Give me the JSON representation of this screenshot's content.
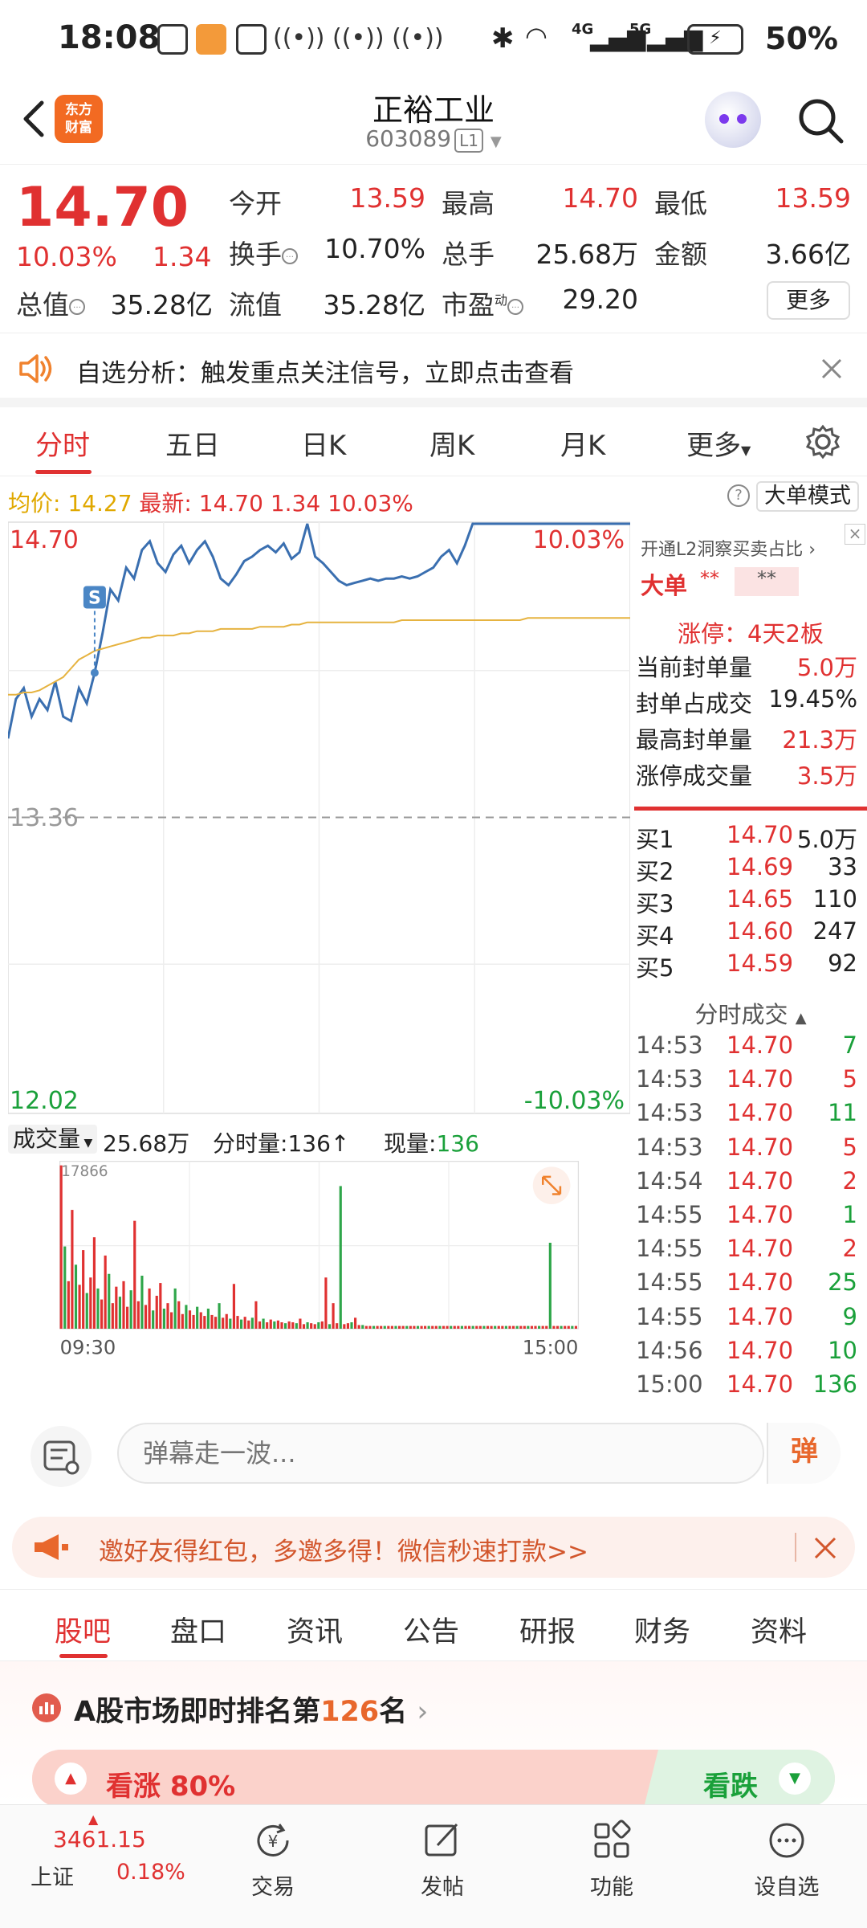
{
  "status_bar": {
    "time": "18:08",
    "net_4g": "4G",
    "net_5g": "5G",
    "battery": "50%"
  },
  "header": {
    "brand": "东方财富",
    "stock_name": "正裕工业",
    "stock_code": "603089",
    "level": "L1"
  },
  "quote": {
    "price": "14.70",
    "change_pct": "10.03%",
    "change": "1.34",
    "fields": [
      {
        "label": "今开",
        "value": "13.59"
      },
      {
        "label": "最高",
        "value": "14.70"
      },
      {
        "label": "最低",
        "value": "13.59"
      },
      {
        "label": "换手",
        "value": "10.70%"
      },
      {
        "label": "总手",
        "value": "25.68万"
      },
      {
        "label": "金额",
        "value": "3.66亿"
      },
      {
        "label": "总值",
        "value": "35.28亿"
      },
      {
        "label": "流值",
        "value": "35.28亿"
      },
      {
        "label": "市盈",
        "value": "29.20"
      }
    ],
    "pe_sup": "动",
    "more": "更多"
  },
  "banner": {
    "text": "自选分析：触发重点关注信号，立即点击查看"
  },
  "chart_tabs": [
    "分时",
    "五日",
    "日K",
    "周K",
    "月K",
    "更多"
  ],
  "avg_line": {
    "avg_label": "均价:",
    "avg_value": "14.27",
    "latest_label": "最新:",
    "latest_value": "14.70",
    "change": "1.34",
    "pct": "10.03%",
    "big_order_mode": "大单模式"
  },
  "chart_data": {
    "type": "line",
    "y_top_label": "14.70",
    "y_mid_label": "13.36",
    "y_bottom_label": "12.02",
    "pct_top_label": "10.03%",
    "pct_bottom_label": "-10.03%",
    "ylim": [
      12.02,
      14.7
    ],
    "reference": 13.36,
    "x_start": "09:30",
    "x_end": "15:00",
    "series": [
      {
        "values": [
          13.72,
          13.9,
          13.95,
          13.82,
          13.9,
          13.85,
          13.98,
          13.82,
          13.8,
          13.95,
          13.88,
          14.02,
          14.2,
          14.4,
          14.35,
          14.5,
          14.45,
          14.58,
          14.62,
          14.52,
          14.48,
          14.56,
          14.6,
          14.52,
          14.58,
          14.62,
          14.55,
          14.45,
          14.42,
          14.47,
          14.53,
          14.55,
          14.58,
          14.6,
          14.57,
          14.61,
          14.54,
          14.57,
          14.7,
          14.55,
          14.52,
          14.48,
          14.44,
          14.42,
          14.43,
          14.44,
          14.45,
          14.44,
          14.45,
          14.45,
          14.46,
          14.45,
          14.46,
          14.48,
          14.5,
          14.55,
          14.58,
          14.52,
          14.6,
          14.7,
          14.7,
          14.7,
          14.7,
          14.7,
          14.7,
          14.7,
          14.7,
          14.7,
          14.7,
          14.7,
          14.7,
          14.7,
          14.7,
          14.7,
          14.7,
          14.7,
          14.7,
          14.7,
          14.7,
          14.7
        ]
      },
      {
        "values": [
          13.92,
          13.92,
          13.93,
          13.93,
          13.94,
          13.96,
          13.98,
          14.0,
          14.04,
          14.08,
          14.1,
          14.12,
          14.13,
          14.14,
          14.15,
          14.16,
          14.17,
          14.18,
          14.18,
          14.19,
          14.19,
          14.19,
          14.2,
          14.2,
          14.21,
          14.21,
          14.21,
          14.22,
          14.22,
          14.22,
          14.22,
          14.22,
          14.23,
          14.23,
          14.23,
          14.23,
          14.24,
          14.24,
          14.25,
          14.25,
          14.25,
          14.25,
          14.25,
          14.25,
          14.25,
          14.25,
          14.25,
          14.25,
          14.25,
          14.25,
          14.26,
          14.26,
          14.26,
          14.26,
          14.26,
          14.26,
          14.26,
          14.26,
          14.26,
          14.26,
          14.26,
          14.26,
          14.26,
          14.26,
          14.26,
          14.26,
          14.27,
          14.27,
          14.27,
          14.27,
          14.27,
          14.27,
          14.27,
          14.27,
          14.27,
          14.27,
          14.27,
          14.27,
          14.27,
          14.27
        ]
      }
    ],
    "marker": "S"
  },
  "volume": {
    "label": "成交量",
    "total": "25.68万",
    "minute_label": "分时量:",
    "minute_value": "136",
    "current_label": "现量:",
    "current_value": "136",
    "max_label": "17866",
    "bars": [
      17866,
      9000,
      5200,
      13000,
      7000,
      4800,
      8600,
      3900,
      5600,
      10000,
      4400,
      3200,
      8000,
      6000,
      2800,
      4600,
      3500,
      5200,
      2400,
      4200,
      11800,
      3000,
      5800,
      2600,
      4400,
      2000,
      3600,
      5000,
      2200,
      2800,
      1800,
      4400,
      3000,
      1600,
      2600,
      2000,
      1500,
      2400,
      1800,
      1400,
      2200,
      1500,
      1300,
      2800,
      1200,
      1600,
      1100,
      4900,
      1400,
      1000,
      1300,
      900,
      1200,
      3000,
      800,
      1100,
      700,
      1000,
      800,
      900,
      700,
      600,
      800,
      700,
      600,
      1100,
      500,
      700,
      600,
      500,
      700,
      800,
      5600,
      500,
      2800,
      600,
      15600,
      500,
      600,
      700,
      1200,
      400,
      400,
      300,
      300,
      300,
      300,
      300,
      300,
      300,
      300,
      300,
      300,
      300,
      300,
      300,
      300,
      300,
      300,
      300,
      300,
      300,
      300,
      300,
      300,
      300,
      300,
      300,
      300,
      300,
      300,
      300,
      300,
      300,
      300,
      300,
      300,
      300,
      300,
      300,
      300,
      300,
      300,
      300,
      300,
      300,
      300,
      300,
      300,
      300,
      300,
      300,
      300,
      9400,
      300,
      300,
      300,
      300,
      300,
      300,
      300
    ]
  },
  "side_panel": {
    "l2_text": "开通L2洞察买卖占比",
    "big_label": "大单",
    "big_stars": "**",
    "big_stars2": "**",
    "limit_up": "涨停：4天2板",
    "stats": [
      {
        "label": "当前封单量",
        "value": "5.0万"
      },
      {
        "label": "封单占成交",
        "value": "19.45%"
      },
      {
        "label": "最高封单量",
        "value": "21.3万"
      },
      {
        "label": "涨停成交量",
        "value": "3.5万"
      }
    ],
    "bids": [
      {
        "label": "买1",
        "price": "14.70",
        "vol": "5.0万"
      },
      {
        "label": "买2",
        "price": "14.69",
        "vol": "33"
      },
      {
        "label": "买3",
        "price": "14.65",
        "vol": "110"
      },
      {
        "label": "买4",
        "price": "14.60",
        "vol": "247"
      },
      {
        "label": "买5",
        "price": "14.59",
        "vol": "92"
      }
    ],
    "ticks_title": "分时成交",
    "ticks": [
      {
        "time": "14:53",
        "price": "14.70",
        "vol": "7"
      },
      {
        "time": "14:53",
        "price": "14.70",
        "vol": "5"
      },
      {
        "time": "14:53",
        "price": "14.70",
        "vol": "11"
      },
      {
        "time": "14:53",
        "price": "14.70",
        "vol": "5"
      },
      {
        "time": "14:54",
        "price": "14.70",
        "vol": "2"
      },
      {
        "time": "14:55",
        "price": "14.70",
        "vol": "1"
      },
      {
        "time": "14:55",
        "price": "14.70",
        "vol": "2"
      },
      {
        "time": "14:55",
        "price": "14.70",
        "vol": "25"
      },
      {
        "time": "14:55",
        "price": "14.70",
        "vol": "9"
      },
      {
        "time": "14:56",
        "price": "14.70",
        "vol": "10"
      },
      {
        "time": "15:00",
        "price": "14.70",
        "vol": "136"
      }
    ]
  },
  "comment_bar": {
    "placeholder": "弹幕走一波...",
    "danmu_btn": "弹"
  },
  "invite": {
    "text": "邀好友得红包，多邀多得！微信秒速打款>>"
  },
  "bottom_tabs": [
    "股吧",
    "盘口",
    "资讯",
    "公告",
    "研报",
    "财务",
    "资料"
  ],
  "rank": {
    "title_prefix": "A股市场即时排名第",
    "rank_no": "126",
    "title_suffix": "名",
    "bull_label": "看涨 80%",
    "bear_label": "看跌"
  },
  "nav": {
    "index_value": "3461.15",
    "index_name": "上证",
    "index_pct": "0.18%",
    "items": [
      {
        "label": "交易",
        "icon": "yuan-exchange-icon"
      },
      {
        "label": "发帖",
        "icon": "edit-post-icon"
      },
      {
        "label": "功能",
        "icon": "grid-function-icon"
      },
      {
        "label": "设自选",
        "icon": "more-dots-icon"
      }
    ]
  }
}
